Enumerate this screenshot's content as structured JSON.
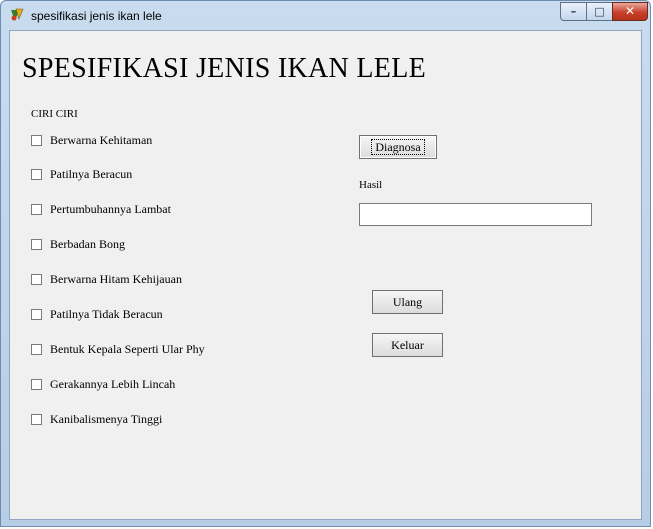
{
  "window": {
    "title": "spesifikasi jenis ikan lele",
    "minimize_glyph": "–",
    "maximize_glyph": "□",
    "close_glyph": "✕"
  },
  "form": {
    "heading": "SPESIFIKASI JENIS IKAN LELE",
    "group_label": "CIRI CIRI",
    "checkboxes": [
      {
        "label": "Berwarna Kehitaman",
        "checked": false
      },
      {
        "label": "Patilnya Beracun",
        "checked": false
      },
      {
        "label": "Pertumbuhannya Lambat",
        "checked": false
      },
      {
        "label": "Berbadan Bong",
        "checked": false
      },
      {
        "label": "Berwarna Hitam Kehijauan",
        "checked": false
      },
      {
        "label": "Patilnya Tidak Beracun",
        "checked": false
      },
      {
        "label": "Bentuk Kepala Seperti Ular Phy",
        "checked": false
      },
      {
        "label": "Gerakannya Lebih Lincah",
        "checked": false
      },
      {
        "label": "Kanibalismenya Tinggi",
        "checked": false
      }
    ],
    "diagnosa_label": "Diagnosa",
    "hasil_label": "Hasil",
    "hasil_value": "",
    "ulang_label": "Ulang",
    "keluar_label": "Keluar"
  }
}
